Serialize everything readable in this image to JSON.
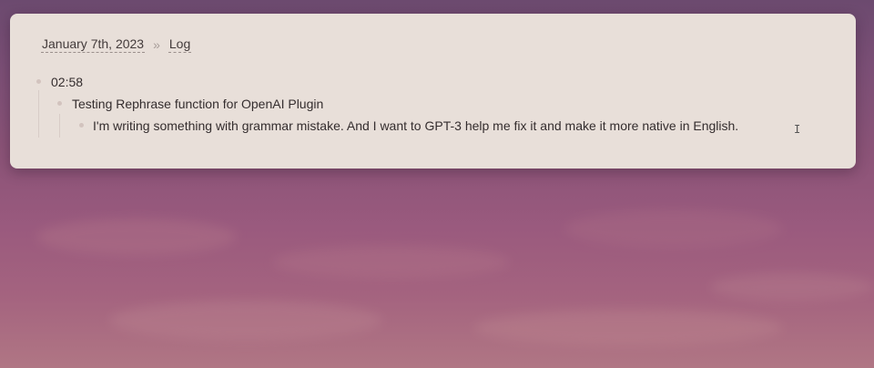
{
  "breadcrumb": {
    "page": "January 7th, 2023",
    "separator": "»",
    "section": "Log"
  },
  "blocks": [
    {
      "text": "02:58"
    },
    {
      "text": "Testing Rephrase function for OpenAI Plugin"
    },
    {
      "text": "I'm writing something with grammar mistake. And I want to GPT-3 help me fix it and make it more native in English."
    }
  ],
  "cursor_glyph": "I"
}
